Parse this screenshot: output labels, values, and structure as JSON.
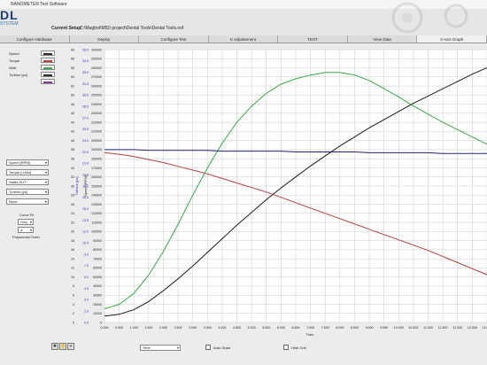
{
  "app": {
    "title": "NANOMETER Test Software",
    "logo": "DL",
    "logo_sub": "SYSTEM"
  },
  "setup": {
    "label": "Current Setup:",
    "path": "C:\\Magtrol\\M5D project\\Dental Tools\\Dental Tools.nsf"
  },
  "tabs": [
    {
      "label": "Configure Hardware"
    },
    {
      "label": "Deploy"
    },
    {
      "label": "Configure Test"
    },
    {
      "label": "K Adjustement"
    },
    {
      "label": "TEST"
    },
    {
      "label": "View Data"
    },
    {
      "label": "3-Axis Graph"
    }
  ],
  "legend": [
    {
      "name": "Speed",
      "color": "#2a2a2a"
    },
    {
      "name": "Torque",
      "color": "#b83c3c"
    },
    {
      "name": "Watt",
      "color": "#3aa84a"
    },
    {
      "name": "Turbine [ps]",
      "color": "#2a2a2a"
    },
    {
      "name": "",
      "color": "#8a3a9a"
    }
  ],
  "controls": {
    "axis1": "Speed [RPM]",
    "axis2": "Torque [n.Nm]",
    "axis3": "Watts OUT",
    "axis4": "Turbine [ps]",
    "axis5": "None",
    "curve_fit_label": "Curve Fit",
    "curve_fit_value": "Only",
    "order_value": "4",
    "order_label": "Polynomial Order"
  },
  "bottom": {
    "x_select": "Time",
    "auto_scale": "Auto Scale",
    "hide_grid": "Hide Grid"
  },
  "colors": {
    "speed": "#1a1a1a",
    "torque": "#b83c3c",
    "watt": "#3aa84a",
    "turbine": "#22227a",
    "grid": "#c8c8c8",
    "plot_bg": "#ffffff"
  },
  "chart_data": {
    "type": "line",
    "xlabel": "Time",
    "xlim": [
      0,
      13.0
    ],
    "x": [
      0,
      0.5,
      1,
      1.5,
      2,
      2.5,
      3,
      3.5,
      4,
      4.5,
      5,
      5.5,
      6,
      6.5,
      7,
      7.5,
      8,
      8.5,
      9,
      9.5,
      10,
      10.5,
      11,
      11.5,
      12,
      12.5,
      13
    ],
    "x_ticks": [
      "0.000",
      "0.500",
      "1.000",
      "1.500",
      "2.000",
      "2.500",
      "3.000",
      "3.500",
      "4.000",
      "4.500",
      "5.000",
      "5.500",
      "6.000",
      "6.500",
      "7.000",
      "7.500",
      "8.000",
      "8.500",
      "9.000",
      "9.500",
      "10.000",
      "10.500",
      "11.000",
      "11.500",
      "12.000",
      "12.500",
      "13.000"
    ],
    "axes": [
      {
        "ticks": [
          "0",
          "2",
          "4",
          "6",
          "8",
          "10",
          "12",
          "14",
          "16",
          "18",
          "20",
          "22",
          "24",
          "26",
          "28",
          "30",
          "32",
          "34",
          "36",
          "38",
          "40",
          "42",
          "44",
          "46",
          "48",
          "50",
          "52",
          "54",
          "56",
          "58",
          "60"
        ]
      },
      {
        "label": "Turbine [ps]",
        "ticks": [
          "0.0",
          "1.5",
          "3.0",
          "4.5",
          "6.0",
          "7.5",
          "9.0",
          "10.5",
          "12.0",
          "13.5",
          "15.0",
          "16.5",
          "18.0",
          "19.5",
          "21.0",
          "22.5",
          "24.0",
          "25.5",
          "27.0",
          "28.5",
          "30.0",
          "31.5",
          "33.0",
          "34.5",
          "36.0"
        ]
      },
      {
        "label": "Speed [RPM]",
        "ticks": [
          "0",
          "10000",
          "20000",
          "30000",
          "40000",
          "50000",
          "60000",
          "70000",
          "80000",
          "90000",
          "100000",
          "110000",
          "120000",
          "130000",
          "140000",
          "150000",
          "160000",
          "170000",
          "180000",
          "190000",
          "200000",
          "210000",
          "220000",
          "230000",
          "240000",
          "250000",
          "260000",
          "270000",
          "280000",
          "290000",
          "300000"
        ]
      }
    ],
    "ylim": [
      0,
      300000
    ],
    "series": [
      {
        "name": "Speed",
        "axis": 2,
        "values": [
          7000,
          9000,
          14000,
          23000,
          35000,
          48000,
          62000,
          77000,
          92000,
          107000,
          121000,
          135000,
          148000,
          160000,
          172000,
          183000,
          194000,
          204000,
          214000,
          223000,
          232000,
          241000,
          249000,
          257000,
          265000,
          273000,
          280000
        ]
      },
      {
        "name": "Torque",
        "axis": 1,
        "values": [
          22.4,
          22.2,
          21.9,
          21.5,
          21.1,
          20.6,
          20.1,
          19.6,
          19.0,
          18.4,
          17.8,
          17.2,
          16.5,
          15.8,
          15.1,
          14.4,
          13.7,
          13.0,
          12.3,
          11.6,
          10.9,
          10.2,
          9.5,
          8.7,
          7.9,
          7.1,
          6.3
        ]
      },
      {
        "name": "Watt",
        "axis": 2,
        "values": [
          15000,
          20000,
          32000,
          52000,
          78000,
          108000,
          140000,
          170000,
          197000,
          220000,
          238000,
          252000,
          262000,
          268000,
          272000,
          275000,
          275000,
          272000,
          266000,
          257000,
          248000,
          238000,
          229000,
          220000,
          212000,
          204000,
          196000
        ]
      },
      {
        "name": "Turbine [ps]",
        "axis": 1,
        "values": [
          22.8,
          22.8,
          22.8,
          22.7,
          22.7,
          22.7,
          22.7,
          22.7,
          22.6,
          22.6,
          22.6,
          22.6,
          22.6,
          22.5,
          22.5,
          22.5,
          22.5,
          22.5,
          22.4,
          22.4,
          22.4,
          22.4,
          22.4,
          22.3,
          22.3,
          22.3,
          22.3
        ]
      }
    ]
  }
}
